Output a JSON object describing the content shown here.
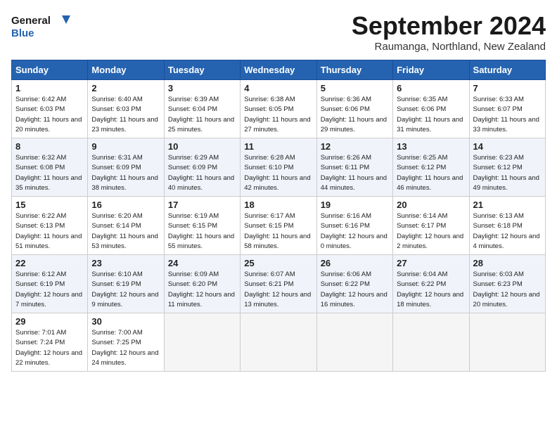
{
  "header": {
    "logo_text_top": "General",
    "logo_text_bottom": "Blue",
    "month_title": "September 2024",
    "location": "Raumanga, Northland, New Zealand"
  },
  "days_of_week": [
    "Sunday",
    "Monday",
    "Tuesday",
    "Wednesday",
    "Thursday",
    "Friday",
    "Saturday"
  ],
  "weeks": [
    [
      {
        "day": "1",
        "sunrise": "6:42 AM",
        "sunset": "6:03 PM",
        "daylight": "11 hours and 20 minutes."
      },
      {
        "day": "2",
        "sunrise": "6:40 AM",
        "sunset": "6:03 PM",
        "daylight": "11 hours and 23 minutes."
      },
      {
        "day": "3",
        "sunrise": "6:39 AM",
        "sunset": "6:04 PM",
        "daylight": "11 hours and 25 minutes."
      },
      {
        "day": "4",
        "sunrise": "6:38 AM",
        "sunset": "6:05 PM",
        "daylight": "11 hours and 27 minutes."
      },
      {
        "day": "5",
        "sunrise": "6:36 AM",
        "sunset": "6:06 PM",
        "daylight": "11 hours and 29 minutes."
      },
      {
        "day": "6",
        "sunrise": "6:35 AM",
        "sunset": "6:06 PM",
        "daylight": "11 hours and 31 minutes."
      },
      {
        "day": "7",
        "sunrise": "6:33 AM",
        "sunset": "6:07 PM",
        "daylight": "11 hours and 33 minutes."
      }
    ],
    [
      {
        "day": "8",
        "sunrise": "6:32 AM",
        "sunset": "6:08 PM",
        "daylight": "11 hours and 35 minutes."
      },
      {
        "day": "9",
        "sunrise": "6:31 AM",
        "sunset": "6:09 PM",
        "daylight": "11 hours and 38 minutes."
      },
      {
        "day": "10",
        "sunrise": "6:29 AM",
        "sunset": "6:09 PM",
        "daylight": "11 hours and 40 minutes."
      },
      {
        "day": "11",
        "sunrise": "6:28 AM",
        "sunset": "6:10 PM",
        "daylight": "11 hours and 42 minutes."
      },
      {
        "day": "12",
        "sunrise": "6:26 AM",
        "sunset": "6:11 PM",
        "daylight": "11 hours and 44 minutes."
      },
      {
        "day": "13",
        "sunrise": "6:25 AM",
        "sunset": "6:12 PM",
        "daylight": "11 hours and 46 minutes."
      },
      {
        "day": "14",
        "sunrise": "6:23 AM",
        "sunset": "6:12 PM",
        "daylight": "11 hours and 49 minutes."
      }
    ],
    [
      {
        "day": "15",
        "sunrise": "6:22 AM",
        "sunset": "6:13 PM",
        "daylight": "11 hours and 51 minutes."
      },
      {
        "day": "16",
        "sunrise": "6:20 AM",
        "sunset": "6:14 PM",
        "daylight": "11 hours and 53 minutes."
      },
      {
        "day": "17",
        "sunrise": "6:19 AM",
        "sunset": "6:15 PM",
        "daylight": "11 hours and 55 minutes."
      },
      {
        "day": "18",
        "sunrise": "6:17 AM",
        "sunset": "6:15 PM",
        "daylight": "11 hours and 58 minutes."
      },
      {
        "day": "19",
        "sunrise": "6:16 AM",
        "sunset": "6:16 PM",
        "daylight": "12 hours and 0 minutes."
      },
      {
        "day": "20",
        "sunrise": "6:14 AM",
        "sunset": "6:17 PM",
        "daylight": "12 hours and 2 minutes."
      },
      {
        "day": "21",
        "sunrise": "6:13 AM",
        "sunset": "6:18 PM",
        "daylight": "12 hours and 4 minutes."
      }
    ],
    [
      {
        "day": "22",
        "sunrise": "6:12 AM",
        "sunset": "6:19 PM",
        "daylight": "12 hours and 7 minutes."
      },
      {
        "day": "23",
        "sunrise": "6:10 AM",
        "sunset": "6:19 PM",
        "daylight": "12 hours and 9 minutes."
      },
      {
        "day": "24",
        "sunrise": "6:09 AM",
        "sunset": "6:20 PM",
        "daylight": "12 hours and 11 minutes."
      },
      {
        "day": "25",
        "sunrise": "6:07 AM",
        "sunset": "6:21 PM",
        "daylight": "12 hours and 13 minutes."
      },
      {
        "day": "26",
        "sunrise": "6:06 AM",
        "sunset": "6:22 PM",
        "daylight": "12 hours and 16 minutes."
      },
      {
        "day": "27",
        "sunrise": "6:04 AM",
        "sunset": "6:22 PM",
        "daylight": "12 hours and 18 minutes."
      },
      {
        "day": "28",
        "sunrise": "6:03 AM",
        "sunset": "6:23 PM",
        "daylight": "12 hours and 20 minutes."
      }
    ],
    [
      {
        "day": "29",
        "sunrise": "7:01 AM",
        "sunset": "7:24 PM",
        "daylight": "12 hours and 22 minutes."
      },
      {
        "day": "30",
        "sunrise": "7:00 AM",
        "sunset": "7:25 PM",
        "daylight": "12 hours and 24 minutes."
      },
      null,
      null,
      null,
      null,
      null
    ]
  ]
}
